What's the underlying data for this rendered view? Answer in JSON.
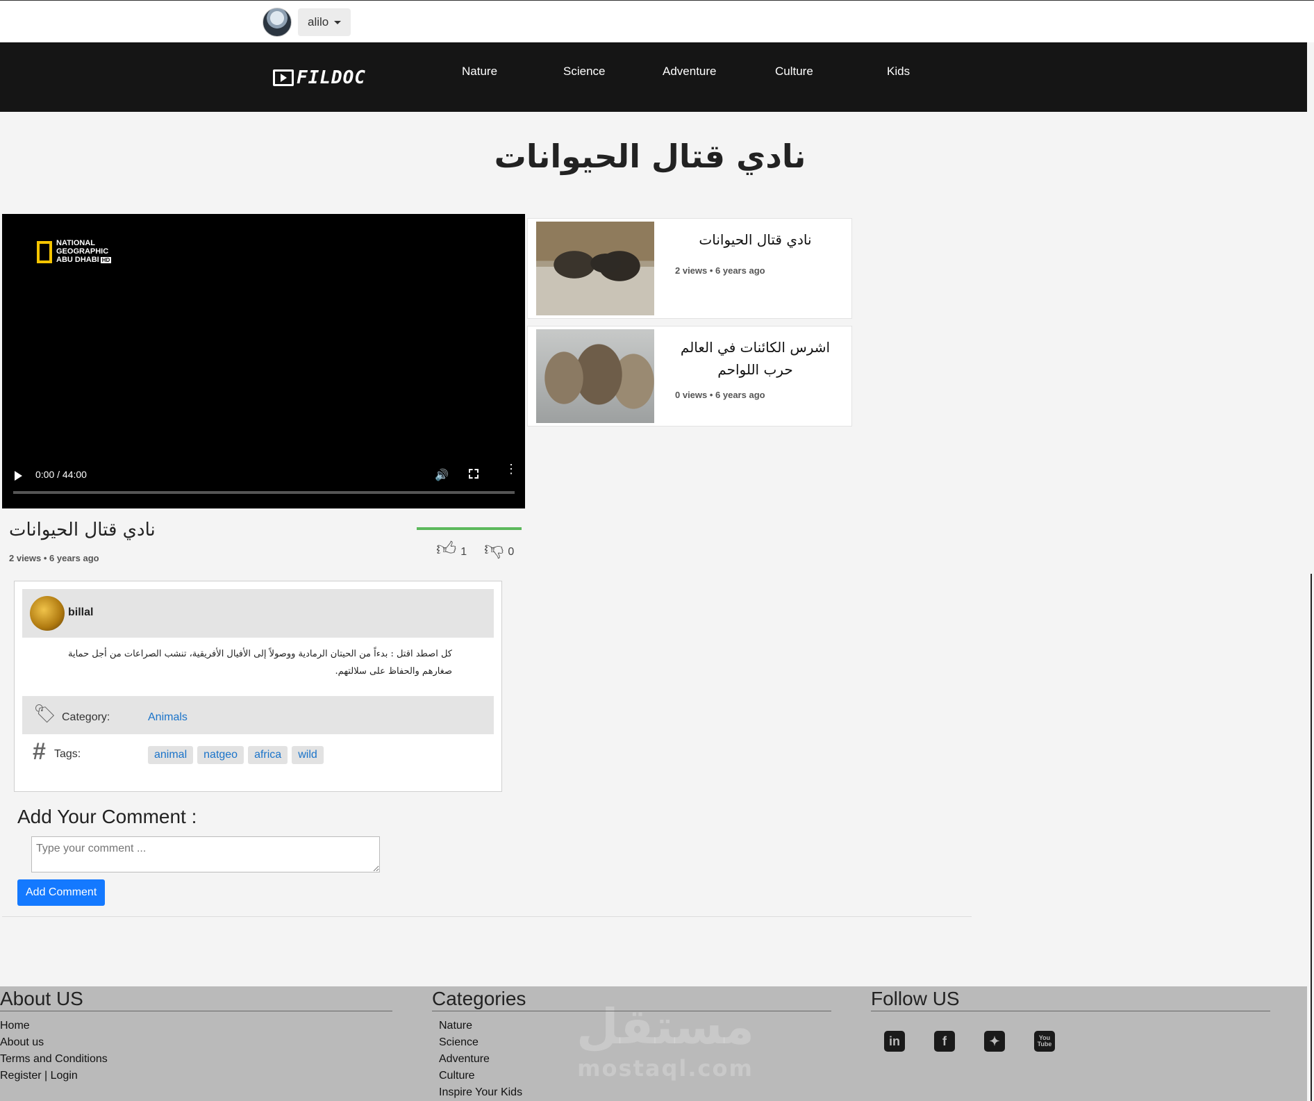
{
  "user": {
    "name": "alilo"
  },
  "nav": {
    "logo": "FILDOC",
    "items": [
      "Nature",
      "Science",
      "Adventure",
      "Culture",
      "Kids"
    ]
  },
  "page": {
    "title": "نادي قتال الحيوانات"
  },
  "video": {
    "time": "0:00 / 44:00",
    "overlay": {
      "line1": "NATIONAL",
      "line2": "GEOGRAPHIC",
      "line3": "ABU DHABI",
      "hd": "HD"
    },
    "title": "نادي قتال الحيوانات",
    "meta": "2 views • 6 years ago",
    "likes": "1",
    "dislikes": "0"
  },
  "related": [
    {
      "title": "نادي قتال الحيوانات",
      "meta": "2 views • 6 years ago"
    },
    {
      "title": "اشرس الكائنات في العالم حرب اللواحم",
      "meta": "0 views • 6 years ago"
    }
  ],
  "details": {
    "author": "billal",
    "description": "كل اصطد اقتل : بدءاً من الحيتان الرمادية ووصولاً إلى الأفيال الأفريقية، تنشب الصراعات من أجل حماية صغارهم والحفاظ على سلالتهم.",
    "category_label": "Category:",
    "category": "Animals",
    "tags_label": "Tags:",
    "tags": [
      "animal",
      "natgeo",
      "africa",
      "wild"
    ]
  },
  "comment": {
    "title": "Add Your Comment :",
    "placeholder": "Type your comment ...",
    "button": "Add Comment"
  },
  "footer": {
    "about_title": "About US",
    "about_links": [
      "Home",
      "About us",
      "Terms and Conditions",
      "Register | Login"
    ],
    "categories_title": "Categories",
    "category_links": [
      "Nature",
      "Science",
      "Adventure",
      "Culture",
      "Inspire Your Kids"
    ],
    "follow_title": "Follow US",
    "watermark": "مستقل",
    "watermark_sub": "mostaql.com"
  }
}
